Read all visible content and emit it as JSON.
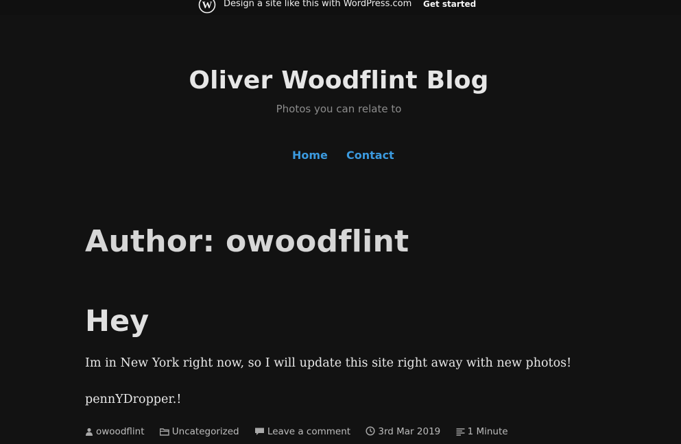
{
  "wpbar": {
    "promo_text": "Design a site like this with WordPress.com",
    "get_started": "Get started"
  },
  "site": {
    "title": "Oliver Woodflint Blog",
    "tagline": "Photos you can relate to"
  },
  "nav": {
    "items": [
      "Home",
      "Contact"
    ]
  },
  "archive": {
    "title": "Author: owoodflint"
  },
  "post": {
    "title": "Hey",
    "body": "Im in New York right now, so I will update this site right away with new photos!",
    "sign": "pennYDropper.!",
    "meta": {
      "author": "owoodflint",
      "category": "Uncategorized",
      "comments": "Leave a comment",
      "date": "3rd Mar 2019",
      "read_time": "1 Minute"
    }
  },
  "colors": {
    "background": "#121212",
    "nav_link": "#3b9adf",
    "text": "#e2e2e2",
    "muted": "#8c8c8c"
  },
  "icons": [
    "wordpress-logo-icon",
    "user-icon",
    "folder-icon",
    "comment-icon",
    "clock-icon",
    "reading-time-icon"
  ]
}
